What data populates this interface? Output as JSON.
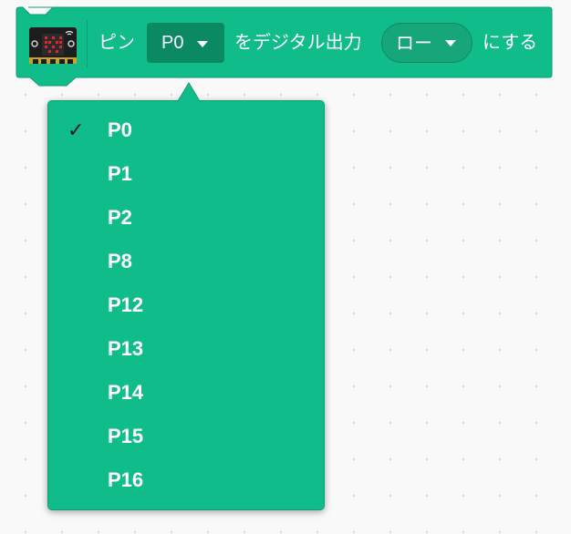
{
  "colors": {
    "block": "#10bc8a",
    "block_border": "#0e9d73",
    "dropdown_field": "#0b8a62",
    "menu_bg": "#11bc8b",
    "check": "#1a1a1a",
    "text": "#ffffff",
    "workspace": "#f9f9f9"
  },
  "block": {
    "extension_icon": "microbit-icon",
    "text_pin": "ピン",
    "pin_dropdown": {
      "value": "P0",
      "icon": "caret-down-icon"
    },
    "text_digital": "をデジタル出力",
    "level_dropdown": {
      "value": "ロー",
      "icon": "caret-down-icon"
    },
    "text_suffix": "にする"
  },
  "menu": {
    "check_mark": "✓",
    "items": [
      {
        "label": "P0",
        "selected": true
      },
      {
        "label": "P1",
        "selected": false
      },
      {
        "label": "P2",
        "selected": false
      },
      {
        "label": "P8",
        "selected": false
      },
      {
        "label": "P12",
        "selected": false
      },
      {
        "label": "P13",
        "selected": false
      },
      {
        "label": "P14",
        "selected": false
      },
      {
        "label": "P15",
        "selected": false
      },
      {
        "label": "P16",
        "selected": false
      }
    ]
  }
}
